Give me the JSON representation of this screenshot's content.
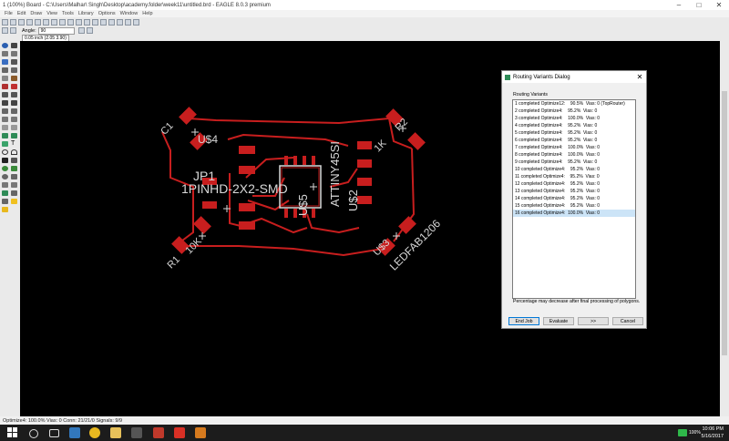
{
  "window": {
    "title": "1 (100%) Board - C:\\Users\\Malhar\\ Singh\\Desktop\\academy.folder\\week11\\untitled.brd - EAGLE 8.0.3 premium"
  },
  "menu": [
    "File",
    "Edit",
    "Draw",
    "View",
    "Tools",
    "Library",
    "Options",
    "Window",
    "Help"
  ],
  "toolbar2": {
    "angle_label": "Angle:",
    "angle_value": "90"
  },
  "coordinates": "0.05 inch (2.05 3.90)",
  "board": {
    "labels": {
      "c1": "C1",
      "u4": "U$4",
      "jp1": "JP1",
      "pinhd": "1PINHD-2X2-SMD",
      "u2": "U$2",
      "attiny": "ATTINY45SI",
      "u5": "U$5",
      "r2": "R2",
      "onek": "1K",
      "tenk": "10K",
      "r1": "R1",
      "u3": "U$3",
      "led": "LEDFAB1206"
    }
  },
  "dialog": {
    "title": "Routing Variants Dialog",
    "list_label": "Routing Variants",
    "variants": [
      "1 completed Optimize12:    90.5%  Vias: 0 (TopRouter)",
      "2 completed Optimize4:    95.2%  Vias: 0",
      "3 completed Optimize4:    100.0%  Vias: 0",
      "4 completed Optimize4:    95.2%  Vias: 0",
      "5 completed Optimize4:    95.2%  Vias: 0",
      "6 completed Optimize4:    95.2%  Vias: 0",
      "7 completed Optimize4:    100.0%  Vias: 0",
      "8 completed Optimize4:    100.0%  Vias: 0",
      "9 completed Optimize4:    95.2%  Vias: 0",
      "10 completed Optimize4:    95.2%  Vias: 0",
      "11 completed Optimize4:    95.2%  Vias: 0",
      "12 completed Optimize4:    95.2%  Vias: 0",
      "13 completed Optimize4:    95.2%  Vias: 0",
      "14 completed Optimize4:    95.2%  Vias: 0",
      "15 completed Optimize4:    95.2%  Vias: 0",
      "16 completed Optimize4:  100.0%  Vias: 0"
    ],
    "selected_index": 15,
    "note": "Percentage may decrease after final processing of polygons.",
    "buttons": {
      "end_job": "End Job",
      "evaluate": "Evaluate",
      "next": ">>",
      "cancel": "Cancel"
    }
  },
  "status": "Optimize4: 100.0%  Vias: 0  Conn: 21/21/0  Signals: 9/9",
  "tray": {
    "battery": "100%",
    "time": "10:06 PM",
    "date": "5/16/2017"
  },
  "colors": {
    "copper": "#c81e1e",
    "silk": "#d8d8d8",
    "board_bg": "#000000",
    "selection": "#cce4f7"
  }
}
